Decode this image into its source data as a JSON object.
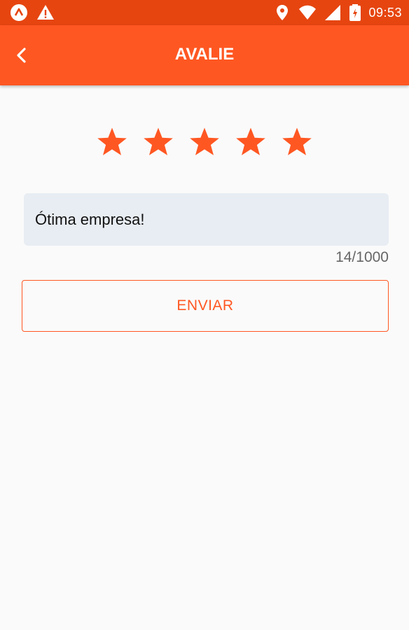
{
  "status_bar": {
    "time": "09:53",
    "left_icons": [
      "app-notification-icon",
      "warning-icon"
    ],
    "right_icons": [
      "location-icon",
      "wifi-icon",
      "signal-icon",
      "battery-charging-icon"
    ]
  },
  "toolbar": {
    "title": "AVALIE",
    "back_icon": "chevron-left-icon"
  },
  "rating": {
    "value": 5,
    "max": 5
  },
  "review": {
    "text": "Ótima empresa!",
    "counter": "14/1000"
  },
  "submit": {
    "label": "ENVIAR"
  },
  "colors": {
    "status_bar": "#e64510",
    "toolbar": "#ff5722",
    "accent": "#ff5722",
    "field_bg": "#e8edf3",
    "background": "#fafafa"
  }
}
